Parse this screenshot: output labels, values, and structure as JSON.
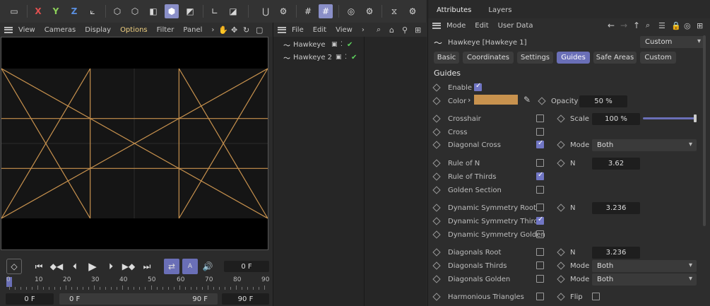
{
  "toolbar": {
    "x_label": "X",
    "y_label": "Y",
    "z_label": "Z"
  },
  "viewport_menu": {
    "items": [
      "View",
      "Cameras",
      "Display",
      "Options",
      "Filter",
      "Panel"
    ],
    "more": "›"
  },
  "object_menu": {
    "items": [
      "File",
      "Edit",
      "View"
    ],
    "more": "›"
  },
  "objects": [
    {
      "name": "Hawkeye"
    },
    {
      "name": "Hawkeye 2"
    }
  ],
  "timeline": {
    "frame_field": "0 F",
    "ruler": [
      "0",
      "10",
      "20",
      "30",
      "40",
      "50",
      "60",
      "70",
      "80",
      "90"
    ],
    "start": "0 F",
    "range_start": "0 F",
    "range_end": "90 F",
    "end": "90 F"
  },
  "attributes": {
    "tabs": [
      "Attributes",
      "Layers"
    ],
    "menu": [
      "Mode",
      "Edit",
      "User Data"
    ],
    "object_title": "Hawkeye [Hawkeye 1]",
    "preset": "Custom",
    "prop_tabs": [
      "Basic",
      "Coordinates",
      "Settings",
      "Guides",
      "Safe Areas",
      "Custom"
    ],
    "section": "Guides",
    "enable_label": "Enable",
    "color_label": "Color",
    "color_value": "#c8924e",
    "opacity_label": "Opacity",
    "opacity_value": "50 %",
    "rows": [
      {
        "label": "Crosshair",
        "checked": false,
        "r_label": "Scale",
        "r_value": "100 %"
      },
      {
        "label": "Cross",
        "checked": false
      },
      {
        "label": "Diagonal Cross",
        "checked": true,
        "r_label": "Mode",
        "r_value": "Both"
      },
      {
        "label": "Rule of N",
        "checked": false,
        "r_label": "N",
        "r_value": "3.62"
      },
      {
        "label": "Rule of Thirds",
        "checked": true
      },
      {
        "label": "Golden Section",
        "checked": false
      },
      {
        "label": "Dynamic Symmetry Root",
        "checked": false,
        "r_label": "N",
        "r_value": "3.236"
      },
      {
        "label": "Dynamic Symmetry Thirds",
        "checked": true
      },
      {
        "label": "Dynamic Symmetry Golden",
        "checked": false
      },
      {
        "label": "Diagonals Root",
        "checked": false,
        "r_label": "N",
        "r_value": "3.236"
      },
      {
        "label": "Diagonals Thirds",
        "checked": false,
        "r_label": "Mode",
        "r_value": "Both"
      },
      {
        "label": "Diagonals Golden",
        "checked": false,
        "r_label": "Mode",
        "r_value": "Both"
      },
      {
        "label": "Harmonious Triangles",
        "checked": false,
        "r_label": "Flip"
      }
    ]
  },
  "colors": {
    "accent": "#7176c4",
    "guide": "#c8924e"
  }
}
